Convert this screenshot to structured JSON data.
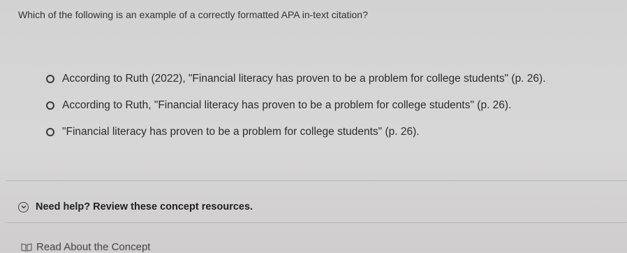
{
  "question": {
    "text": "Which of the following is an example of a correctly formatted APA in-text citation?"
  },
  "options": [
    {
      "text": "According to Ruth (2022), \"Financial literacy has proven to be a problem for college students\" (p. 26)."
    },
    {
      "text": "According to Ruth, \"Financial literacy has proven to be a problem for college students\" (p. 26)."
    },
    {
      "text": "\"Financial literacy has proven to be a problem for college students\" (p. 26)."
    }
  ],
  "help": {
    "label": "Need help? Review these concept resources.",
    "icon": "chevron-down-icon"
  },
  "resources": {
    "read_label": "Read About the Concept",
    "icon": "book-icon"
  }
}
